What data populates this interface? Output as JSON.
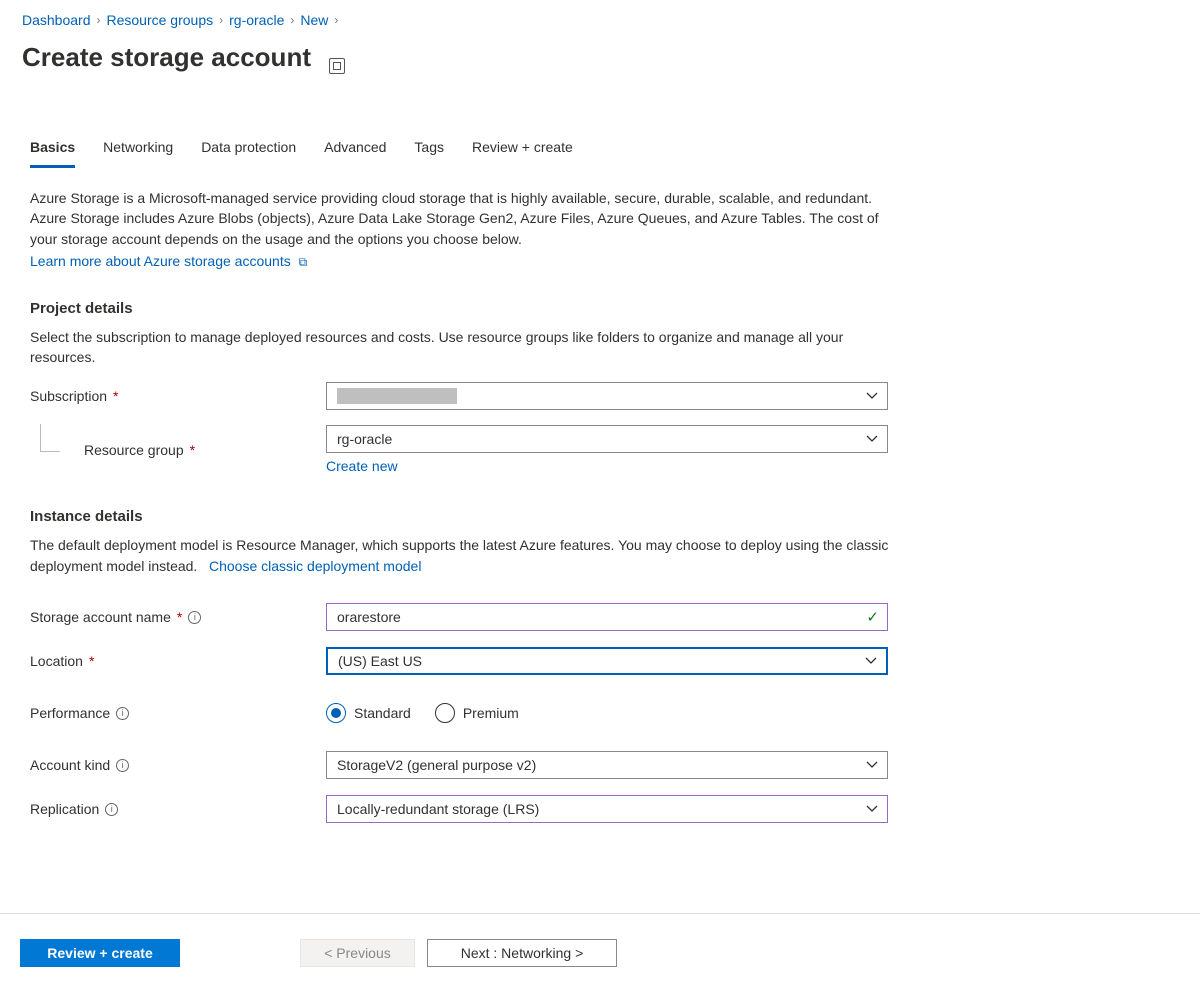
{
  "breadcrumb": {
    "items": [
      "Dashboard",
      "Resource groups",
      "rg-oracle",
      "New"
    ]
  },
  "page_title": "Create storage account",
  "tabs": [
    "Basics",
    "Networking",
    "Data protection",
    "Advanced",
    "Tags",
    "Review + create"
  ],
  "active_tab": "Basics",
  "intro": {
    "text": "Azure Storage is a Microsoft-managed service providing cloud storage that is highly available, secure, durable, scalable, and redundant. Azure Storage includes Azure Blobs (objects), Azure Data Lake Storage Gen2, Azure Files, Azure Queues, and Azure Tables. The cost of your storage account depends on the usage and the options you choose below.",
    "link": "Learn more about Azure storage accounts"
  },
  "project_details": {
    "title": "Project details",
    "desc": "Select the subscription to manage deployed resources and costs. Use resource groups like folders to organize and manage all your resources.",
    "subscription_label": "Subscription",
    "subscription_value": "",
    "resource_group_label": "Resource group",
    "resource_group_value": "rg-oracle",
    "create_new": "Create new"
  },
  "instance_details": {
    "title": "Instance details",
    "desc": "The default deployment model is Resource Manager, which supports the latest Azure features. You may choose to deploy using the classic deployment model instead.",
    "classic_link": "Choose classic deployment model",
    "name_label": "Storage account name",
    "name_value": "orarestore",
    "location_label": "Location",
    "location_value": "(US) East US",
    "performance_label": "Performance",
    "performance_options": {
      "standard": "Standard",
      "premium": "Premium"
    },
    "performance_selected": "standard",
    "account_kind_label": "Account kind",
    "account_kind_value": "StorageV2 (general purpose v2)",
    "replication_label": "Replication",
    "replication_value": "Locally-redundant storage (LRS)"
  },
  "footer": {
    "review": "Review + create",
    "previous": "< Previous",
    "next": "Next : Networking >"
  }
}
